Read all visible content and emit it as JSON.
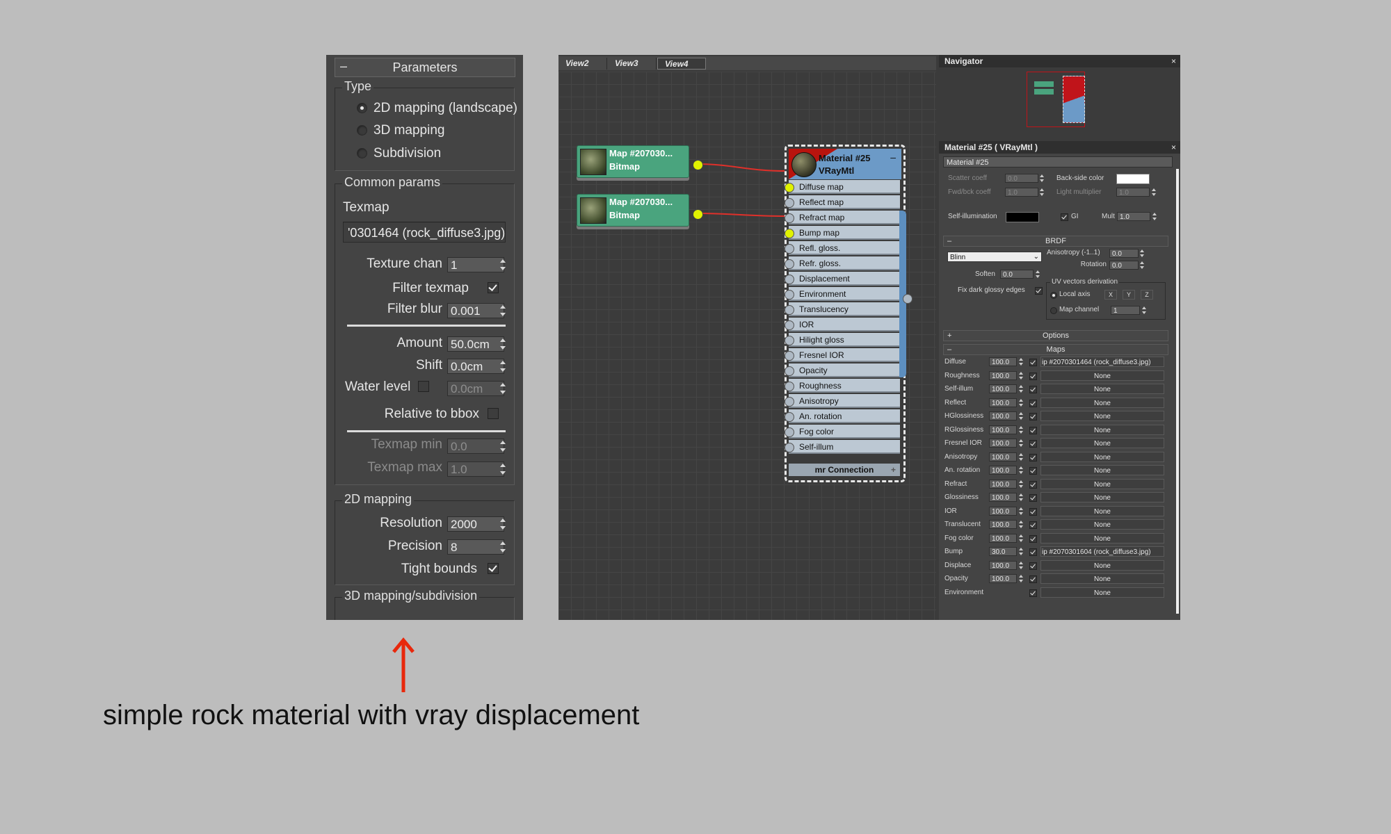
{
  "parameters": {
    "title": "Parameters",
    "collapse": "–",
    "type_group": {
      "label": "Type",
      "options": [
        "2D mapping (landscape)",
        "3D mapping",
        "Subdivision"
      ],
      "selected": "2D mapping (landscape)"
    },
    "common_group": {
      "label": "Common params",
      "texmap_label": "Texmap",
      "texmap_value": "'0301464 (rock_diffuse3.jpg)",
      "texture_chan_label": "Texture chan",
      "texture_chan_value": "1",
      "filter_texmap_label": "Filter texmap",
      "filter_texmap_checked": true,
      "filter_blur_label": "Filter blur",
      "filter_blur_value": "0.001",
      "amount_label": "Amount",
      "amount_value": "50.0cm",
      "shift_label": "Shift",
      "shift_value": "0.0cm",
      "water_level_label": "Water level",
      "water_level_value": "0.0cm",
      "relative_bbox_label": "Relative to bbox",
      "texmap_min_label": "Texmap min",
      "texmap_min_value": "0.0",
      "texmap_max_label": "Texmap max",
      "texmap_max_value": "1.0"
    },
    "mapping2d_group": {
      "label": "2D mapping",
      "resolution_label": "Resolution",
      "resolution_value": "2000",
      "precision_label": "Precision",
      "precision_value": "8",
      "tight_bounds_label": "Tight bounds",
      "tight_bounds_checked": true
    },
    "mapping3d_group": {
      "label": "3D mapping/subdivision"
    }
  },
  "editor": {
    "tabs": [
      "View2",
      "View3",
      "View4"
    ],
    "active_tab": "View4",
    "bitmap_nodes": [
      {
        "title": "Map #207030...",
        "type": "Bitmap"
      },
      {
        "title": "Map #207030...",
        "type": "Bitmap"
      }
    ],
    "material_node": {
      "title": "Material #25",
      "type": "VRayMtl",
      "collapse": "–",
      "slots": [
        "Diffuse map",
        "Reflect map",
        "Refract map",
        "Bump map",
        "Refl. gloss.",
        "Refr. gloss.",
        "Displacement",
        "Environment",
        "Translucency",
        "IOR",
        "Hilight gloss",
        "Fresnel IOR",
        "Opacity",
        "Roughness",
        "Anisotropy",
        "An. rotation",
        "Fog color",
        "Self-illum"
      ],
      "connected_slots": [
        "Diffuse map",
        "Bump map"
      ],
      "footer": "mr Connection",
      "footer_plus": "+"
    }
  },
  "navigator": {
    "title": "Navigator",
    "close": "×"
  },
  "material_panel": {
    "title": "Material #25  ( VRayMtl )",
    "close": "×",
    "name_field": "Material #25",
    "scatter_coeff_label": "Scatter coeff",
    "scatter_coeff_value": "0.0",
    "fwd_bck_label": "Fwd/bck coeff",
    "fwd_bck_value": "1.0",
    "back_side_label": "Back-side color",
    "light_mult_label": "Light multiplier",
    "light_mult_value": "1.0",
    "self_illum_label": "Self-illumination",
    "gi_label": "GI",
    "mult_label": "Mult",
    "mult_value": "1.0",
    "brdf": {
      "title": "BRDF",
      "type": "Blinn",
      "anisotropy_label": "Anisotropy (-1..1)",
      "anisotropy_value": "0.0",
      "rotation_label": "Rotation",
      "rotation_value": "0.0",
      "soften_label": "Soften",
      "soften_value": "0.0",
      "fix_dark_label": "Fix dark glossy edges",
      "uv_label": "UV vectors derivation",
      "local_axis_label": "Local axis",
      "axes": [
        "X",
        "Y",
        "Z"
      ],
      "map_channel_label": "Map channel",
      "map_channel_value": "1"
    },
    "options_title": "Options",
    "maps_title": "Maps",
    "maps": [
      {
        "name": "Diffuse",
        "amount": "100.0",
        "map": "ip #2070301464 (rock_diffuse3.jpg)"
      },
      {
        "name": "Roughness",
        "amount": "100.0",
        "map": "None"
      },
      {
        "name": "Self-illum",
        "amount": "100.0",
        "map": "None"
      },
      {
        "name": "Reflect",
        "amount": "100.0",
        "map": "None"
      },
      {
        "name": "HGlossiness",
        "amount": "100.0",
        "map": "None"
      },
      {
        "name": "RGlossiness",
        "amount": "100.0",
        "map": "None"
      },
      {
        "name": "Fresnel IOR",
        "amount": "100.0",
        "map": "None"
      },
      {
        "name": "Anisotropy",
        "amount": "100.0",
        "map": "None"
      },
      {
        "name": "An. rotation",
        "amount": "100.0",
        "map": "None"
      },
      {
        "name": "Refract",
        "amount": "100.0",
        "map": "None"
      },
      {
        "name": "Glossiness",
        "amount": "100.0",
        "map": "None"
      },
      {
        "name": "IOR",
        "amount": "100.0",
        "map": "None"
      },
      {
        "name": "Translucent",
        "amount": "100.0",
        "map": "None"
      },
      {
        "name": "Fog color",
        "amount": "100.0",
        "map": "None"
      },
      {
        "name": "Bump",
        "amount": "30.0",
        "map": "ip #2070301604 (rock_diffuse3.jpg)"
      },
      {
        "name": "Displace",
        "amount": "100.0",
        "map": "None"
      },
      {
        "name": "Opacity",
        "amount": "100.0",
        "map": "None"
      },
      {
        "name": "Environment",
        "amount": "",
        "map": "None"
      }
    ]
  },
  "caption": "simple rock material with vray displacement",
  "colors": {
    "arrow": "#e8280c",
    "bitmap_node": "#4aa47e",
    "material_header": "#6c9ac7",
    "connection": "#e0302a"
  }
}
